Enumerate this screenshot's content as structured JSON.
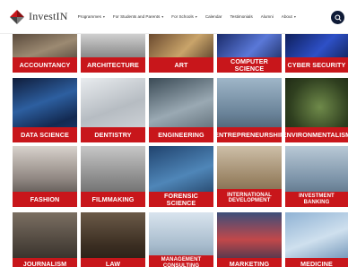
{
  "header": {
    "brand": "InvestIN",
    "nav": [
      {
        "label": "Programmes",
        "caret": true
      },
      {
        "label": "For Students and Parents",
        "caret": true
      },
      {
        "label": "For Schools",
        "caret": true
      },
      {
        "label": "Calendar",
        "caret": false
      },
      {
        "label": "Testimonials",
        "caret": false
      },
      {
        "label": "Alumni",
        "caret": false
      },
      {
        "label": "About",
        "caret": true
      }
    ],
    "search_icon": "search-icon"
  },
  "tiles": [
    {
      "label": "ACCOUNTANCY"
    },
    {
      "label": "ARCHITECTURE"
    },
    {
      "label": "ART"
    },
    {
      "label": "COMPUTER SCIENCE"
    },
    {
      "label": "CYBER SECURITY"
    },
    {
      "label": "DATA SCIENCE"
    },
    {
      "label": "DENTISTRY"
    },
    {
      "label": "ENGINEERING"
    },
    {
      "label": "ENTREPRENEURSHIP"
    },
    {
      "label": "ENVIRONMENTALISM"
    },
    {
      "label": "FASHION"
    },
    {
      "label": "FILMMAKING"
    },
    {
      "label": "FORENSIC SCIENCE"
    },
    {
      "label": "INTERNATIONAL\nDEVELOPMENT"
    },
    {
      "label": "INVESTMENT BANKING"
    },
    {
      "label": "JOURNALISM"
    },
    {
      "label": "LAW"
    },
    {
      "label": "MANAGEMENT\nCONSULTING"
    },
    {
      "label": "MARKETING"
    },
    {
      "label": "MEDICINE"
    }
  ],
  "colors": {
    "label_bg": "#c8161b",
    "search_bg": "#0e1a36"
  }
}
